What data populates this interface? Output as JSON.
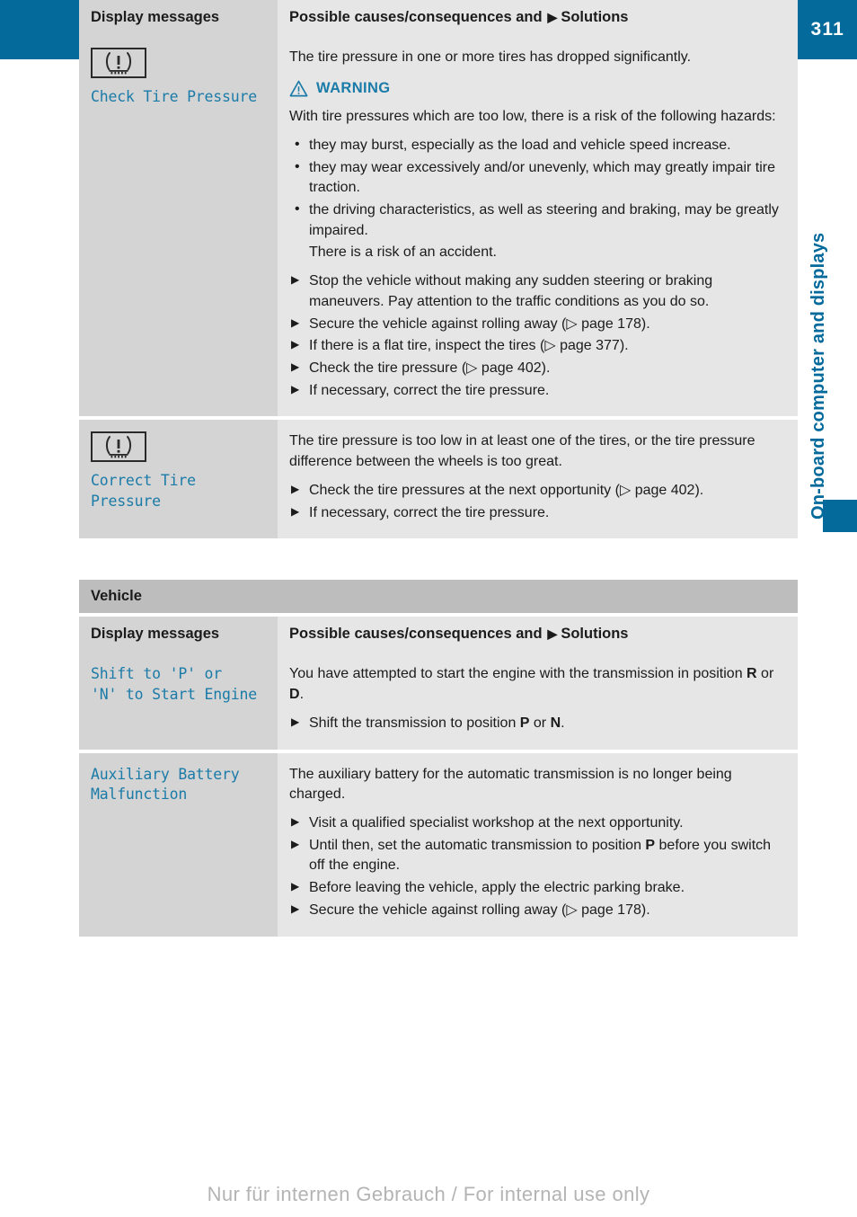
{
  "header": {
    "title": "Display messages",
    "page_number": "311"
  },
  "side_tab": {
    "label": "On-board computer and displays"
  },
  "footer": {
    "watermark": "Nur für internen Gebrauch / For internal use only"
  },
  "colors": {
    "header_blue": "#036a9b",
    "accent_blue": "#1b7ba8",
    "col_left_gray": "#d4d4d4",
    "col_right_gray": "#e6e6e6",
    "section_band_gray": "#bdbdbd"
  },
  "table_headers": {
    "col1": "Display messages",
    "col2_prefix": "Possible causes/consequences and",
    "col2_suffix": "Solutions"
  },
  "table1": {
    "rows": [
      {
        "icon": "tire-pressure-telltale",
        "message": "Check Tire Pressure",
        "intro": "The tire pressure in one or more tires has dropped significantly.",
        "warning_label": "WARNING",
        "warning_intro": "With tire pressures which are too low, there is a risk of the following hazards:",
        "hazards": [
          "they may burst, especially as the load and vehicle speed increase.",
          "they may wear excessively and/or unevenly, which may greatly impair tire traction.",
          "the driving characteristics, as well as steering and braking, may be greatly impaired."
        ],
        "hazard_followup": "There is a risk of an accident.",
        "steps": [
          "Stop the vehicle without making any sudden steering or braking maneuvers. Pay attention to the traffic conditions as you do so.",
          "Secure the vehicle against rolling away (▷ page 178).",
          "If there is a flat tire, inspect the tires (▷ page 377).",
          "Check the tire pressure (▷ page 402).",
          "If necessary, correct the tire pressure."
        ]
      },
      {
        "icon": "tire-pressure-telltale",
        "message": "Correct Tire\nPressure",
        "intro": "The tire pressure is too low in at least one of the tires, or the tire pressure difference between the wheels is too great.",
        "steps": [
          "Check the tire pressures at the next opportunity (▷ page 402).",
          "If necessary, correct the tire pressure."
        ]
      }
    ]
  },
  "table2": {
    "section_title": "Vehicle",
    "rows": [
      {
        "message": "Shift to 'P' or\n'N' to Start Engine",
        "intro_a": "You have attempted to start the engine with the transmission in position ",
        "intro_pos1": "R",
        "intro_mid": " or ",
        "intro_pos2": "D",
        "intro_end": ".",
        "step_a": "Shift the transmission to position ",
        "step_pos1": "P",
        "step_mid": " or ",
        "step_pos2": "N",
        "step_end": "."
      },
      {
        "message": "Auxiliary Battery\nMalfunction",
        "intro": "The auxiliary battery for the automatic transmission is no longer being charged.",
        "step1": "Visit a qualified specialist workshop at the next opportunity.",
        "step2_a": "Until then, set the automatic transmission to position ",
        "step2_pos": "P",
        "step2_b": " before you switch off the engine.",
        "step3": "Before leaving the vehicle, apply the electric parking brake.",
        "step4": "Secure the vehicle against rolling away (▷ page 178)."
      }
    ]
  }
}
